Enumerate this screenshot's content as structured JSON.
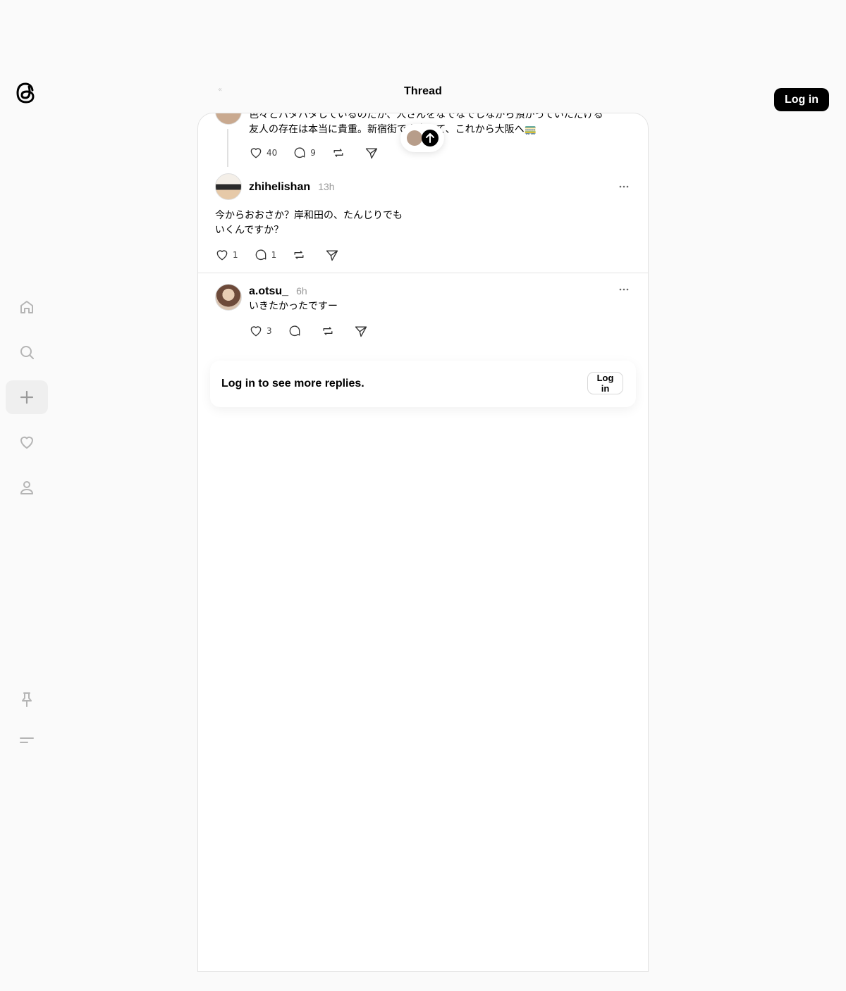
{
  "header": {
    "title": "Thread",
    "back_glyph": "«",
    "login_label": "Log in"
  },
  "sidebar": {
    "items": [
      {
        "name": "home-icon"
      },
      {
        "name": "search-icon"
      },
      {
        "name": "plus-icon",
        "active": true
      },
      {
        "name": "heart-icon"
      },
      {
        "name": "profile-icon"
      }
    ],
    "bottom": [
      {
        "name": "pin-icon"
      },
      {
        "name": "menu-icon"
      }
    ]
  },
  "posts": [
    {
      "text_line1": "色々とバタバタしているのだが、人さんをなでなでしながら預かっていただける",
      "text_line2": "友人の存在は本当に貴重。新宿街で人変えて、これから大阪へ🚃",
      "likes": "40",
      "comments": "9"
    },
    {
      "username": "zhihelishan",
      "time": "13h",
      "text_line1": "今からおおさか？岸和田の、たんじりでも",
      "text_line2": "いくんですか？",
      "likes": "1",
      "comments": "1"
    },
    {
      "username": "a.otsu_",
      "time": "6h",
      "text": "いきたかったですー",
      "likes": "3",
      "comments": ""
    }
  ],
  "login_prompt": {
    "text": "Log in to see more replies.",
    "button": "Log in"
  },
  "colors": {
    "background": "#fafafa",
    "panel": "#ffffff",
    "accent": "#000000",
    "muted": "#999999"
  }
}
